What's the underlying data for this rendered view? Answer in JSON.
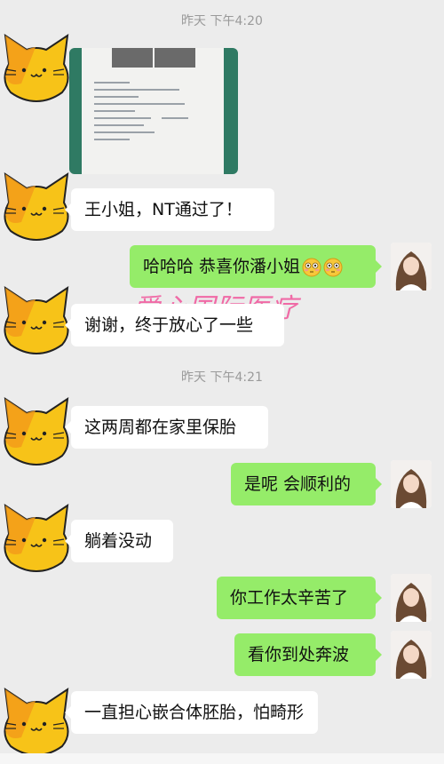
{
  "timestamps": [
    "昨天 下午4:20",
    "昨天 下午4:21"
  ],
  "messages": [
    {
      "side": "left",
      "text": "王小姐，NT通过了！"
    },
    {
      "side": "right",
      "text": "哈哈哈 恭喜你潘小姐"
    },
    {
      "side": "left",
      "text": "谢谢，终于放心了一些"
    },
    {
      "side": "left",
      "text": "这两周都在家里保胎"
    },
    {
      "side": "right",
      "text": "是呢 会顺利的"
    },
    {
      "side": "left",
      "text": "躺着没动"
    },
    {
      "side": "right",
      "text": "你工作太辛苦了"
    },
    {
      "side": "right",
      "text": "看你到处奔波"
    },
    {
      "side": "left",
      "text": "一直担心嵌合体胚胎，怕畸形"
    }
  ],
  "watermark": "爱心国际医疗",
  "icons": {
    "left_avatar": "cat-avatar-icon",
    "right_avatar": "woman-avatar-icon",
    "emoji": "flushed-face-emoji-icon"
  },
  "colors": {
    "right_bubble": "#95ec69",
    "left_bubble": "#ffffff",
    "background": "#ececec",
    "watermark": "#f06aa6"
  }
}
